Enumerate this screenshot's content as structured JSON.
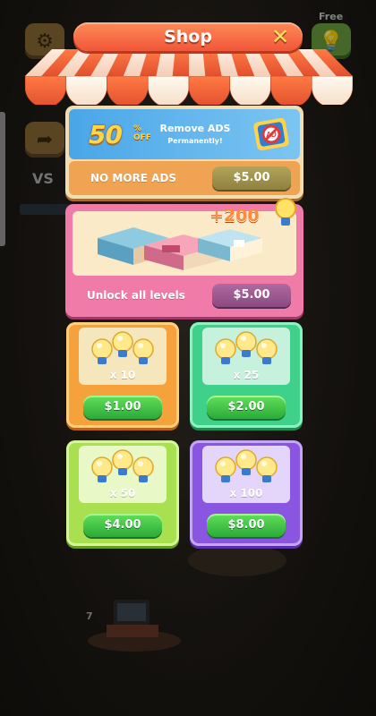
{
  "title": "Shop",
  "free_label": "Free",
  "background": {
    "level_number": "7",
    "vs_text": "VS"
  },
  "remove_ads": {
    "discount": "50",
    "off_line1": "%",
    "off_line2": "OFF",
    "title": "Remove ADS",
    "subtitle": "Permanently!",
    "badge": "AD",
    "label": "NO MORE ADS",
    "price": "$5.00"
  },
  "unlock_levels": {
    "bonus": "+200",
    "label": "Unlock all levels",
    "price": "$5.00"
  },
  "lightbulb_packs": [
    {
      "count": "x 10",
      "price": "$1.00"
    },
    {
      "count": "x 25",
      "price": "$2.00"
    },
    {
      "count": "x 50",
      "price": "$4.00"
    },
    {
      "count": "x 100",
      "price": "$8.00"
    }
  ],
  "colors": {
    "title_bar": "#f0573a",
    "pack_10": "#f5a23c",
    "pack_25": "#3fd08a",
    "pack_50": "#a8e050",
    "pack_100": "#8a55e0",
    "buy_button": "#2aaa38"
  }
}
